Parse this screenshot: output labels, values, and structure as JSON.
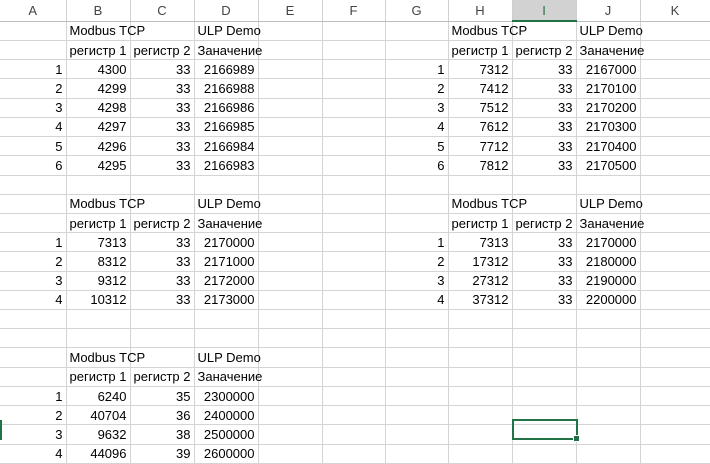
{
  "columns": [
    "A",
    "B",
    "C",
    "D",
    "E",
    "F",
    "G",
    "H",
    "I",
    "J",
    "K"
  ],
  "selected_column": "I",
  "selected_cell": "I22",
  "rows": [
    [
      "",
      "Modbus TCP",
      "",
      "ULP Demo",
      "",
      "",
      "",
      "Modbus TCP",
      "",
      "ULP Demo",
      ""
    ],
    [
      "",
      "регистр 1",
      "регистр 2",
      "Заначение",
      "",
      "",
      "",
      "регистр 1",
      "регистр 2",
      "Заначение",
      ""
    ],
    [
      "1",
      "4300",
      "33",
      "2166989",
      "",
      "",
      "1",
      "7312",
      "33",
      "2167000",
      ""
    ],
    [
      "2",
      "4299",
      "33",
      "2166988",
      "",
      "",
      "2",
      "7412",
      "33",
      "2170100",
      ""
    ],
    [
      "3",
      "4298",
      "33",
      "2166986",
      "",
      "",
      "3",
      "7512",
      "33",
      "2170200",
      ""
    ],
    [
      "4",
      "4297",
      "33",
      "2166985",
      "",
      "",
      "4",
      "7612",
      "33",
      "2170300",
      ""
    ],
    [
      "5",
      "4296",
      "33",
      "2166984",
      "",
      "",
      "5",
      "7712",
      "33",
      "2170400",
      ""
    ],
    [
      "6",
      "4295",
      "33",
      "2166983",
      "",
      "",
      "6",
      "7812",
      "33",
      "2170500",
      ""
    ],
    [
      "",
      "",
      "",
      "",
      "",
      "",
      "",
      "",
      "",
      "",
      ""
    ],
    [
      "",
      "Modbus TCP",
      "",
      "ULP Demo",
      "",
      "",
      "",
      "Modbus TCP",
      "",
      "ULP Demo",
      ""
    ],
    [
      "",
      "регистр 1",
      "регистр 2",
      "Заначение",
      "",
      "",
      "",
      "регистр 1",
      "регистр 2",
      "Заначение",
      ""
    ],
    [
      "1",
      "7313",
      "33",
      "2170000",
      "",
      "",
      "1",
      "7313",
      "33",
      "2170000",
      ""
    ],
    [
      "2",
      "8312",
      "33",
      "2171000",
      "",
      "",
      "2",
      "17312",
      "33",
      "2180000",
      ""
    ],
    [
      "3",
      "9312",
      "33",
      "2172000",
      "",
      "",
      "3",
      "27312",
      "33",
      "2190000",
      ""
    ],
    [
      "4",
      "10312",
      "33",
      "2173000",
      "",
      "",
      "4",
      "37312",
      "33",
      "2200000",
      ""
    ],
    [
      "",
      "",
      "",
      "",
      "",
      "",
      "",
      "",
      "",
      "",
      ""
    ],
    [
      "",
      "",
      "",
      "",
      "",
      "",
      "",
      "",
      "",
      "",
      ""
    ],
    [
      "",
      "Modbus TCP",
      "",
      "ULP Demo",
      "",
      "",
      "",
      "",
      "",
      "",
      ""
    ],
    [
      "",
      "регистр 1",
      "регистр 2",
      "Заначение",
      "",
      "",
      "",
      "",
      "",
      "",
      ""
    ],
    [
      "1",
      "6240",
      "35",
      "2300000",
      "",
      "",
      "",
      "",
      "",
      "",
      ""
    ],
    [
      "2",
      "40704",
      "36",
      "2400000",
      "",
      "",
      "",
      "",
      "",
      "",
      ""
    ],
    [
      "3",
      "9632",
      "38",
      "2500000",
      "",
      "",
      "",
      "",
      "",
      "",
      ""
    ],
    [
      "4",
      "44096",
      "39",
      "2600000",
      "",
      "",
      "",
      "",
      "",
      "",
      ""
    ]
  ]
}
